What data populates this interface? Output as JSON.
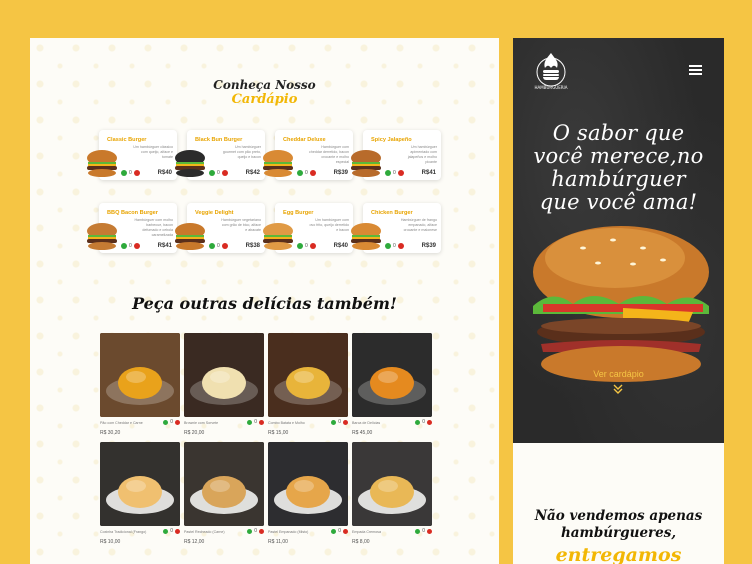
{
  "menu_section": {
    "title_line1": "Conheça Nosso",
    "title_line2": "Cardápio",
    "items": [
      {
        "name": "Classic Burger",
        "desc": "Um hambúrguer clássico com queijo, alface e tomate",
        "qty": "0",
        "price": "R$40"
      },
      {
        "name": "Black Bun Burger",
        "desc": "Um hambúrguer gourmet com pão preto, queijo e bacon",
        "qty": "0",
        "price": "R$42"
      },
      {
        "name": "Cheddar Deluxe",
        "desc": "Hambúrguer com cheddar derretido, bacon crocante e molho especial",
        "qty": "0",
        "price": "R$39"
      },
      {
        "name": "Spicy Jalapeño",
        "desc": "Um hambúrguer apimentado com jalapeños e molho picante",
        "qty": "0",
        "price": "R$41"
      },
      {
        "name": "BBQ Bacon Burger",
        "desc": "Hambúrguer com molho barbecue, bacon defumado e cebola caramelizada",
        "qty": "0",
        "price": "R$41"
      },
      {
        "name": "Veggie Delight",
        "desc": "Hambúrguer vegetariano com grão de bico, alface e abacate",
        "qty": "0",
        "price": "R$38"
      },
      {
        "name": "Egg Burger",
        "desc": "Um hambúrguer com ovo frito, queijo derretido e bacon",
        "qty": "0",
        "price": "R$40"
      },
      {
        "name": "Chicken Burger",
        "desc": "Hambúrguer de frango empanado, alface crocante e maionese",
        "qty": "0",
        "price": "R$39"
      }
    ]
  },
  "others_section": {
    "title": "Peça outras delícias também!",
    "items": [
      {
        "name": "Pão com Cheddar e Carne",
        "qty": "0",
        "price": "R$ 30,20"
      },
      {
        "name": "Brownie com Sorvete",
        "qty": "0",
        "price": "R$ 20,00"
      },
      {
        "name": "Combo Batata e Molho",
        "qty": "0",
        "price": "R$ 15,00"
      },
      {
        "name": "Barca de Delícias",
        "qty": "0",
        "price": "R$ 45,00"
      },
      {
        "name": "Coxinha Tradicional (Frango)",
        "qty": "0",
        "price": "R$ 10,00"
      },
      {
        "name": "Pastel Recheado (Carne)",
        "qty": "0",
        "price": "R$ 12,00"
      },
      {
        "name": "Pastel Empanado (Misto)",
        "qty": "0",
        "price": "R$ 11,00"
      },
      {
        "name": "Empada Cremosa",
        "qty": "0",
        "price": "R$ 8,00"
      }
    ]
  },
  "mobile": {
    "logo_text": "HAMBURGUERIA",
    "headline": [
      "O sabor que",
      "você merece,no",
      "hambúrguer",
      "que você ama!"
    ],
    "cta": "Ver cardápio",
    "lower_title": [
      "Não vendemos apenas",
      "hambúrgueres,"
    ],
    "lower_accent": "entregamos"
  },
  "colors": {
    "brand_yellow": "#f5c544",
    "accent": "#f2b705",
    "dark": "#2a2a2a",
    "add": "#2eaa3c",
    "remove": "#d92b22"
  }
}
